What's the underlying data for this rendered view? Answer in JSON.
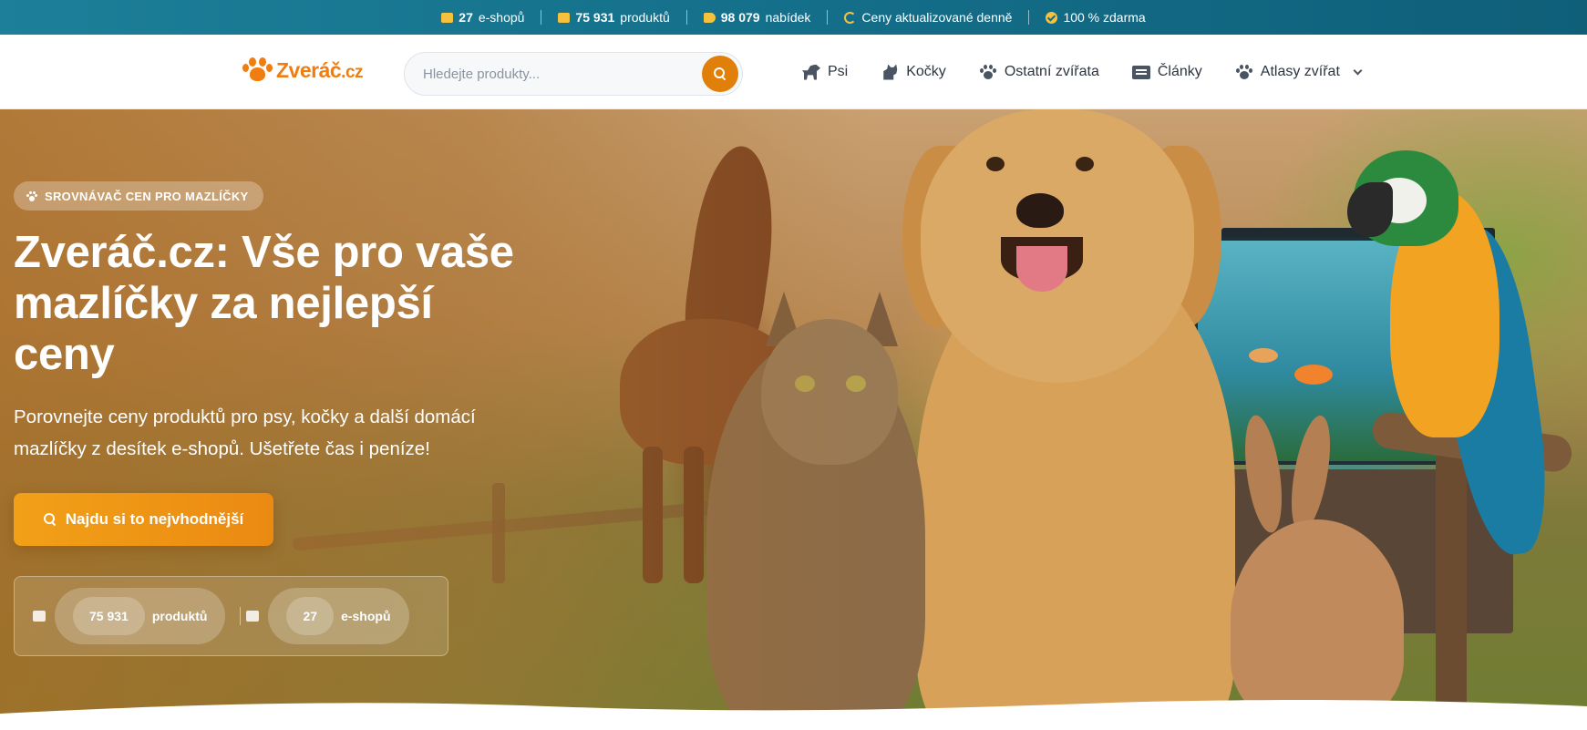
{
  "topbar": {
    "stats": [
      {
        "icon": "store-icon",
        "value": "27",
        "label": "e-shopů"
      },
      {
        "icon": "box-icon",
        "value": "75 931",
        "label": "produktů"
      },
      {
        "icon": "tag-icon",
        "value": "98 079",
        "label": "nabídek"
      },
      {
        "icon": "refresh-icon",
        "value": "",
        "label": "Ceny aktualizované denně"
      },
      {
        "icon": "check-circle-icon",
        "value": "",
        "label": "100 % zdarma"
      }
    ]
  },
  "header": {
    "logo_main": "Zveráč",
    "logo_tld": ".cz",
    "search_placeholder": "Hledejte produkty...",
    "nav": [
      {
        "label": "Psi",
        "icon": "dog-icon"
      },
      {
        "label": "Kočky",
        "icon": "cat-icon"
      },
      {
        "label": "Ostatní zvířata",
        "icon": "paw-icon"
      },
      {
        "label": "Články",
        "icon": "newspaper-icon"
      },
      {
        "label": "Atlasy zvířat",
        "icon": "paw-icon",
        "dropdown": true
      }
    ]
  },
  "hero": {
    "badge": "SROVNÁVAČ CEN PRO MAZLÍČKY",
    "headline": "Zveráč.cz: Vše pro vaše mazlíčky za nejlepší ceny",
    "subtext": "Porovnejte ceny produktů pro psy, kočky a další domácí mazlíčky z desítek e-shopů. Ušetřete čas i peníze!",
    "cta_label": "Najdu si to nejvhodnější",
    "stats": [
      {
        "value": "75 931",
        "label": "produktů",
        "icon": "box-icon"
      },
      {
        "value": "27",
        "label": "e-shopů",
        "icon": "store-icon"
      }
    ]
  },
  "colors": {
    "accent": "#ef7d10",
    "topbar": "#146f8a",
    "icon_yellow": "#f6c23e",
    "nav_text": "#2d3540"
  }
}
